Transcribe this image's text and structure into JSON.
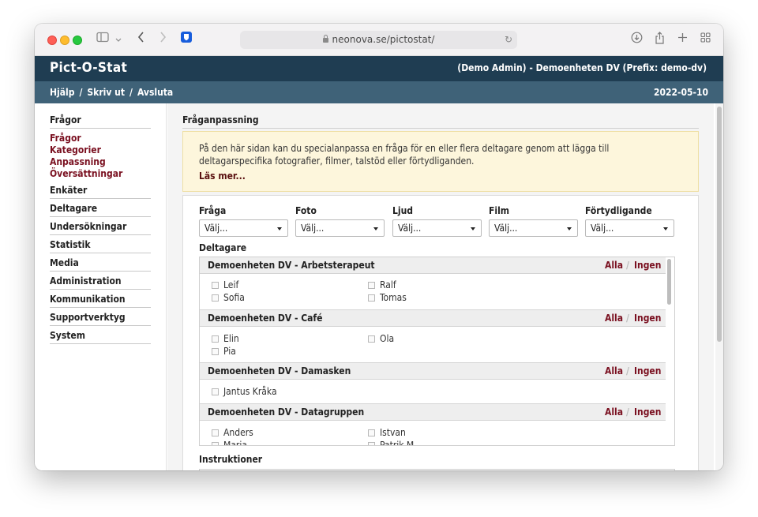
{
  "browser": {
    "url": "neonova.se/pictostat/",
    "icons": [
      "sidebar-icon",
      "chevron-down-icon",
      "back-icon",
      "forward-icon",
      "bitwarden-icon",
      "lock-icon",
      "reload-icon",
      "download-icon",
      "share-icon",
      "new-tab-icon",
      "tab-overview-icon"
    ]
  },
  "header": {
    "brand": "Pict-O-Stat",
    "user": "(Demo Admin) - Demoenheten DV (Prefix: demo-dv)",
    "links": [
      "Hjälp",
      "Skriv ut",
      "Avsluta"
    ],
    "separator": "/",
    "date": "2022-05-10"
  },
  "sidebar": {
    "sections": [
      {
        "label": "Frågor",
        "items": [
          "Frågor",
          "Kategorier",
          "Anpassning",
          "Översättningar"
        ]
      },
      {
        "label": "Enkäter"
      },
      {
        "label": "Deltagare"
      },
      {
        "label": "Undersökningar"
      },
      {
        "label": "Statistik"
      },
      {
        "label": "Media"
      },
      {
        "label": "Administration"
      },
      {
        "label": "Kommunikation"
      },
      {
        "label": "Supportverktyg"
      },
      {
        "label": "System"
      }
    ]
  },
  "main": {
    "title": "Fråganpassning",
    "info": {
      "text": "På den här sidan kan du specialanpassa en fråga för en eller flera deltagare genom att lägga till deltagarspecifika fotografier, filmer, talstöd eller förtydliganden.",
      "more": "Läs mer..."
    },
    "filters": [
      {
        "label": "Fråga",
        "value": "Välj..."
      },
      {
        "label": "Foto",
        "value": "Välj..."
      },
      {
        "label": "Ljud",
        "value": "Välj..."
      },
      {
        "label": "Film",
        "value": "Välj..."
      },
      {
        "label": "Förtydligande",
        "value": "Välj..."
      }
    ],
    "participants_label": "Deltagare",
    "all_label": "Alla",
    "none_label": "Ingen",
    "groups": [
      {
        "name": "Demoenheten DV - Arbetsterapeut",
        "members": [
          "Leif",
          "Ralf",
          "Sofia",
          "Tomas"
        ]
      },
      {
        "name": "Demoenheten DV - Café",
        "members": [
          "Elin",
          "Ola",
          "Pia"
        ]
      },
      {
        "name": "Demoenheten DV - Damasken",
        "members": [
          "Jantus Kråka"
        ]
      },
      {
        "name": "Demoenheten DV - Datagruppen",
        "members": [
          "Anders",
          "Istvan",
          "Maria",
          "Patrik M"
        ]
      }
    ],
    "instructions_label": "Instruktioner"
  },
  "colors": {
    "header_bg": "#1f3d52",
    "subheader_bg": "#3f6278",
    "accent_link": "#7a1020",
    "info_bg": "#fdf6dc"
  }
}
